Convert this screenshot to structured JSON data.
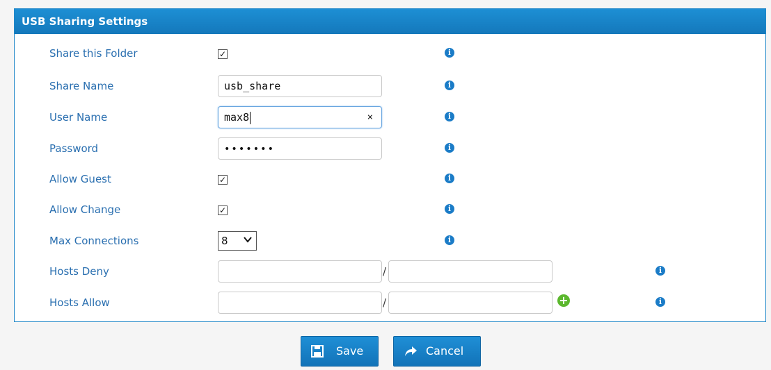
{
  "panel": {
    "title": "USB Sharing Settings"
  },
  "fields": {
    "share_folder": {
      "label": "Share this Folder",
      "checked": true,
      "info": "i"
    },
    "share_name": {
      "label": "Share Name",
      "value": "usb_share",
      "info": "i"
    },
    "user_name": {
      "label": "User Name",
      "value": "max8",
      "clear": "×",
      "info": "i"
    },
    "password": {
      "label": "Password",
      "value": "•••••••",
      "info": "i"
    },
    "allow_guest": {
      "label": "Allow Guest",
      "checked": true,
      "info": "i"
    },
    "allow_change": {
      "label": "Allow Change",
      "checked": true,
      "info": "i"
    },
    "max_connections": {
      "label": "Max Connections",
      "value": "8",
      "info": "i"
    },
    "hosts_deny": {
      "label": "Hosts Deny",
      "separator": "/",
      "info": "i"
    },
    "hosts_allow": {
      "label": "Hosts Allow",
      "separator": "/",
      "add": "+",
      "info": "i"
    }
  },
  "checkmark": "✓",
  "buttons": {
    "save": "Save",
    "cancel": "Cancel"
  },
  "colors": {
    "header": "#1a84c8",
    "label": "#2a6fb0",
    "info": "#1b7cc7",
    "add": "#5cb82e"
  },
  "icons": {
    "info": "info-icon",
    "check": "checkmark-icon",
    "clear": "clear-icon",
    "chevron": "chevron-down-icon",
    "add": "plus-icon",
    "save": "floppy-disk-icon",
    "cancel": "arrow-forward-icon"
  }
}
